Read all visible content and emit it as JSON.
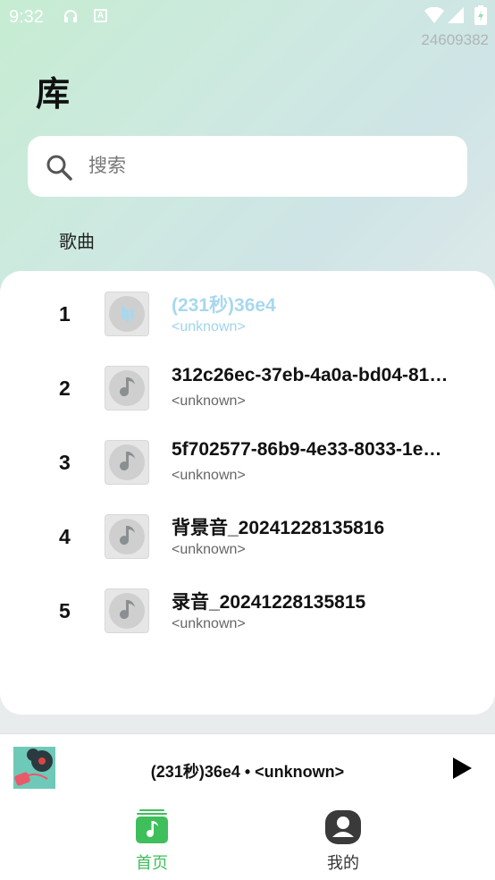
{
  "status_bar": {
    "time": "9:32",
    "counter": "24609382"
  },
  "page": {
    "title": "库"
  },
  "search": {
    "placeholder": "搜索",
    "value": ""
  },
  "section": {
    "label": "歌曲"
  },
  "songs": [
    {
      "index": "1",
      "title": "(231秒)36e4",
      "artist": "<unknown>",
      "playing": true
    },
    {
      "index": "2",
      "title": "312c26ec-37eb-4a0a-bd04-81…",
      "artist": "<unknown>",
      "playing": false
    },
    {
      "index": "3",
      "title": "5f702577-86b9-4e33-8033-1e…",
      "artist": "<unknown>",
      "playing": false
    },
    {
      "index": "4",
      "title": "背景音_20241228135816",
      "artist": "<unknown>",
      "playing": false
    },
    {
      "index": "5",
      "title": "录音_20241228135815",
      "artist": "<unknown>",
      "playing": false
    }
  ],
  "mini_player": {
    "now_playing": "(231秒)36e4 • <unknown>",
    "play_icon": "play-icon"
  },
  "bottom_nav": {
    "home_label": "首页",
    "mine_label": "我的"
  },
  "colors": {
    "accent_green": "#3fbf5c",
    "playing_blue": "#a8d8ee"
  }
}
